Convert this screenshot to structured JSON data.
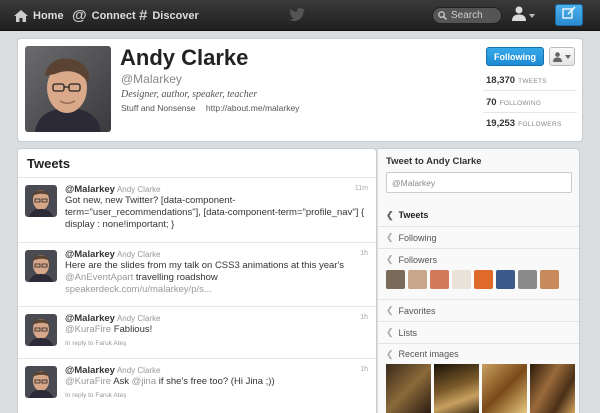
{
  "nav": {
    "home": "Home",
    "connect": "Connect",
    "discover": "Discover",
    "search_placeholder": "Search"
  },
  "profile": {
    "name": "Andy Clarke",
    "handle": "@Malarkey",
    "bio": "Designer, author, speaker, teacher",
    "location": "Stuff and Nonsense",
    "url": "http://about.me/malarkey",
    "follow_label": "Following",
    "stats": [
      {
        "value": "18,370",
        "label": "TWEETS"
      },
      {
        "value": "70",
        "label": "FOLLOWING"
      },
      {
        "value": "19,253",
        "label": "FOLLOWERS"
      }
    ]
  },
  "tweets_panel": {
    "title": "Tweets",
    "items": [
      {
        "handle": "@Malarkey",
        "name": "Andy Clarke",
        "time": "11m",
        "text": "Got new, new Twitter? [data-component-term=\"user_recommendations\"], [data-component-term=\"profile_nav\"] { display : none!important; }"
      },
      {
        "handle": "@Malarkey",
        "name": "Andy Clarke",
        "time": "1h",
        "text": "Here are the slides from my talk on CSS3 animations at this year's",
        "mention": "@AnEventApart",
        "text2": " travelling roadshow",
        "link": "speakerdeck.com/u/malarkey/p/s..."
      },
      {
        "handle": "@Malarkey",
        "name": "Andy Clarke",
        "time": "1h",
        "mention": "@KuraFire",
        "text": " Fablious!",
        "reply": "In reply to Faruk Ateş"
      },
      {
        "handle": "@Malarkey",
        "name": "Andy Clarke",
        "time": "1h",
        "mention": "@KuraFire",
        "text": " Ask ",
        "mention2": "@jina",
        "text2": " if she's free too? (Hi Jina ;))",
        "reply": "In reply to Faruk Ateş"
      }
    ]
  },
  "sidebar": {
    "tweet_to_title": "Tweet to Andy Clarke",
    "tweet_to_value": "@Malarkey",
    "items": {
      "tweets": "Tweets",
      "following": "Following",
      "followers": "Followers",
      "favorites": "Favorites",
      "lists": "Lists",
      "recent_images": "Recent images"
    }
  },
  "colors": {
    "accent": "#1d8bd4",
    "topbar": "#2a2a2a"
  }
}
